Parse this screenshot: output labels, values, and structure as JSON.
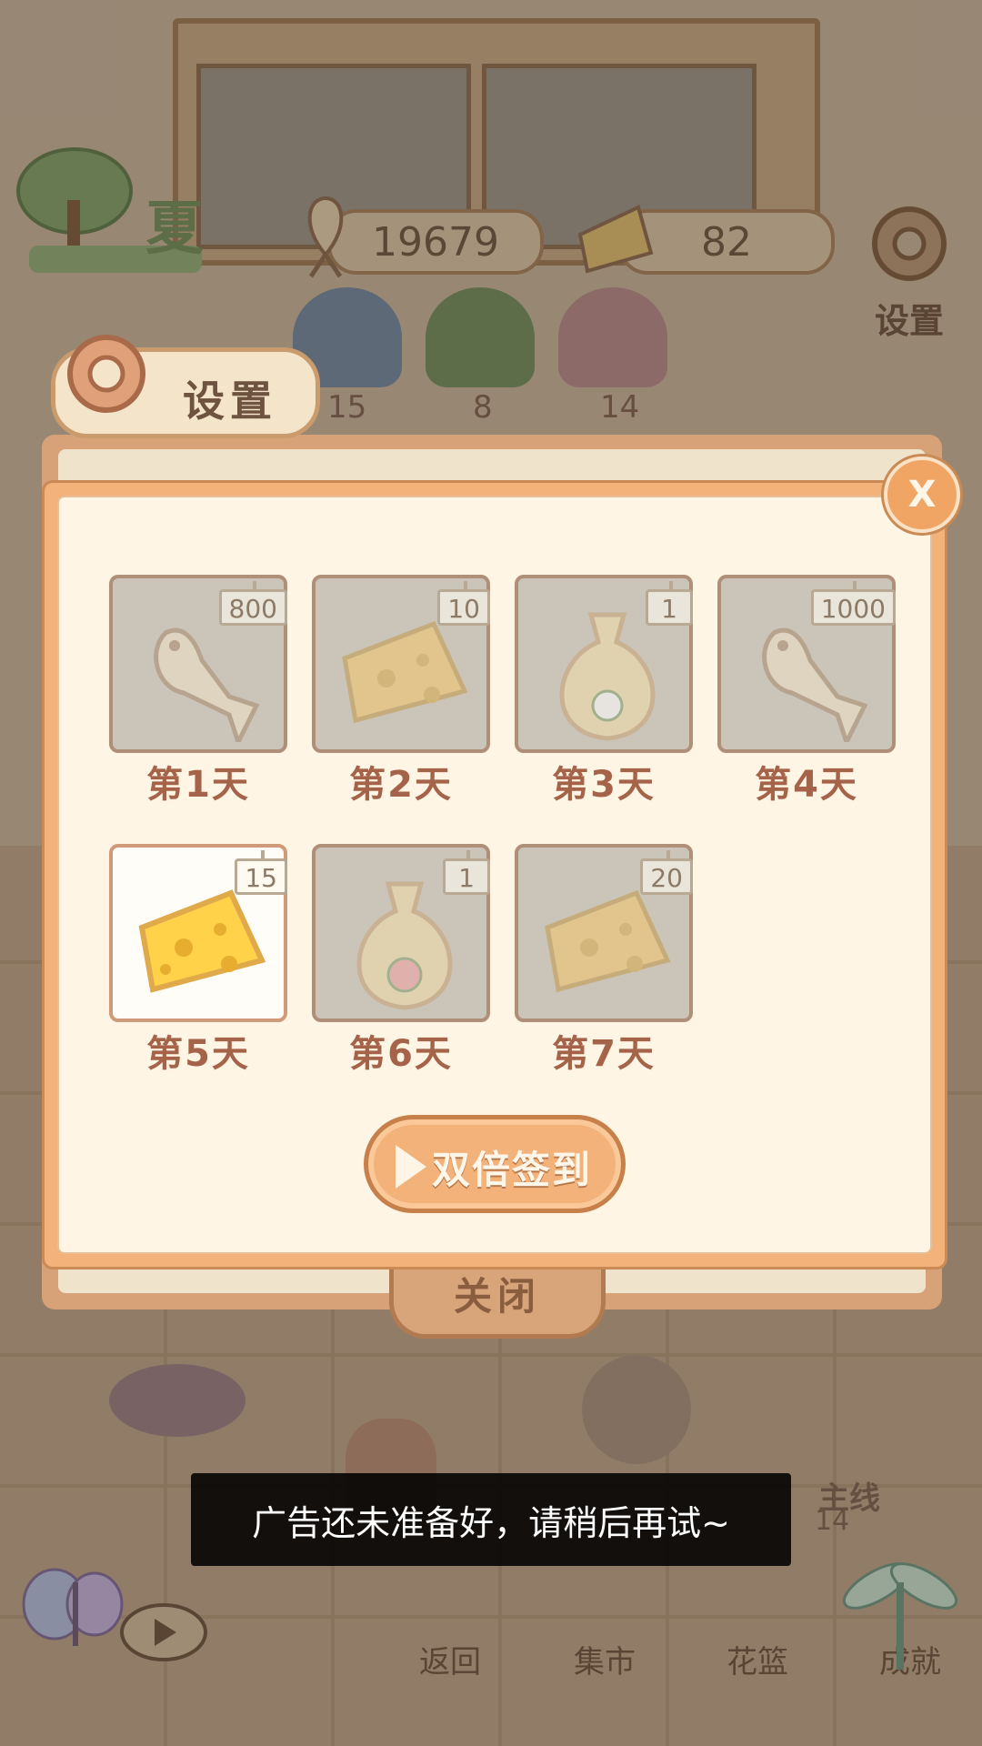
{
  "hud": {
    "season_label": "夏",
    "fish_count": "19679",
    "cheese_count": "82",
    "settings_label": "设置"
  },
  "shelf_counts": [
    "15",
    "8",
    "14"
  ],
  "settings_panel": {
    "title": "设置",
    "close_label": "关闭"
  },
  "signin_dialog": {
    "close_label": "X",
    "days": [
      {
        "label": "第1天",
        "reward": "fish-bone-icon",
        "amount": "800",
        "claimed": false
      },
      {
        "label": "第2天",
        "reward": "cheese-icon",
        "amount": "10",
        "claimed": false
      },
      {
        "label": "第3天",
        "reward": "seed-bag-icon",
        "amount": "1",
        "claimed": false
      },
      {
        "label": "第4天",
        "reward": "fish-bone-icon",
        "amount": "1000",
        "claimed": false
      },
      {
        "label": "第5天",
        "reward": "cheese-icon",
        "amount": "15",
        "claimed": true
      },
      {
        "label": "第6天",
        "reward": "seed-bag-icon",
        "amount": "1",
        "claimed": false
      },
      {
        "label": "第7天",
        "reward": "cheese-icon",
        "amount": "20",
        "claimed": false
      }
    ],
    "double_button_label": "双倍签到"
  },
  "bottom_nav": [
    {
      "label": "返回"
    },
    {
      "label": "集市"
    },
    {
      "label": "花篮"
    },
    {
      "label": "成就"
    }
  ],
  "side_labels": {
    "mainline": "主线",
    "pot_count": "14"
  },
  "toast": {
    "message": "广告还未准备好，请稍后再试~"
  },
  "colors": {
    "dialog_border": "#f3b27a",
    "dialog_bg": "#fff5e4",
    "day_label": "#a5634a",
    "active_cell_bg": "#fffdf8"
  }
}
